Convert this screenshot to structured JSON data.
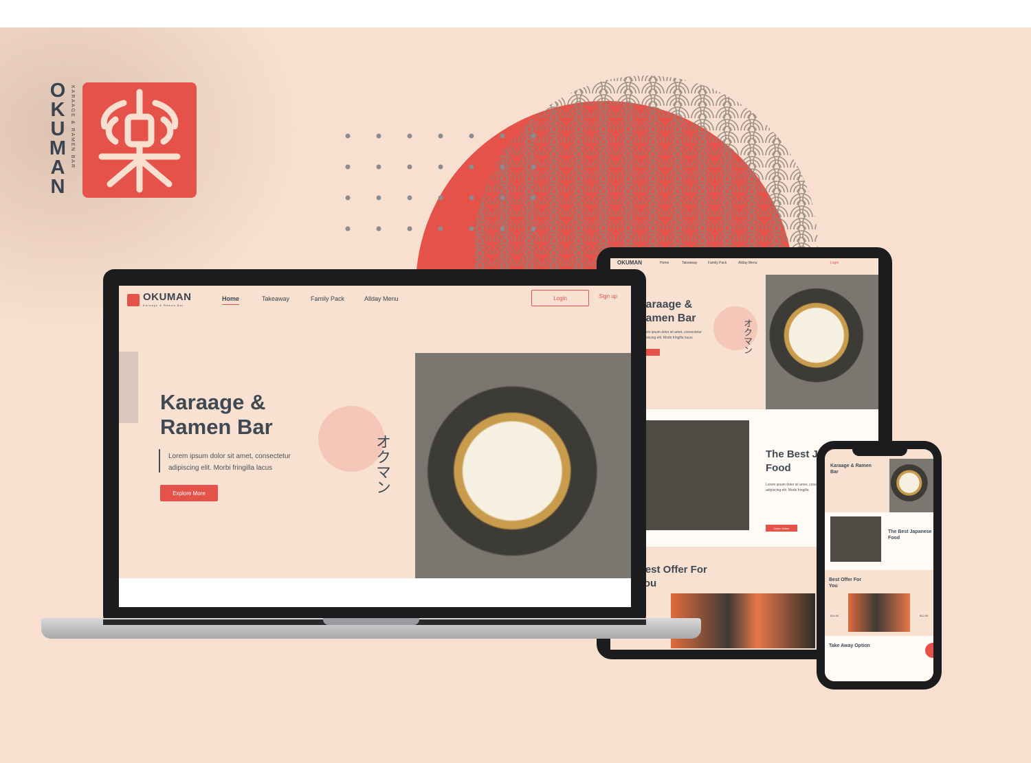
{
  "brand": {
    "letters": [
      "O",
      "K",
      "U",
      "M",
      "A",
      "N"
    ],
    "subtitle": "KARAAGE & RAMEN BAR",
    "accent": "#e5524a",
    "dark": "#3a4350",
    "background": "#f9dfcf"
  },
  "laptop": {
    "logo": "OKUMAN",
    "logo_sub": "Karaage & Ramen Bar",
    "nav": [
      "Home",
      "Takeaway",
      "Family Pack",
      "Allday Menu"
    ],
    "login": "Login",
    "signup": "Sign up",
    "hero_title": "Karaage & Ramen Bar",
    "hero_text": "Lorem ipsum dolor sit amet, consectetur adipiscing elit. Morbi fringilla lacus",
    "hero_button": "Explore More",
    "katakana": "オクマン"
  },
  "tablet": {
    "logo": "OKUMAN",
    "nav": [
      "Home",
      "Takeaway",
      "Family Pack",
      "Allday Menu"
    ],
    "login": "Login",
    "title": "Karaage & Ramen Bar",
    "text": "Lorem ipsum dolor sit amet, consectetur adipiscing elit. Morbi fringilla lacus",
    "katakana": "オクマン",
    "best_title": "The Best Japanese Food",
    "best_text": "Lorem ipsum dolor sit amet, consectetur adipiscing elit. Morbi fringilla",
    "order_button": "Order Online",
    "offer_title": "Best Offer For You"
  },
  "phone": {
    "title": "Karaage & Ramen Bar",
    "best_title": "The Best Japanese Food",
    "offer_title": "Best Offer For You",
    "price1": "$16.00",
    "price2": "$12.00",
    "take_title": "Take Away Option"
  }
}
